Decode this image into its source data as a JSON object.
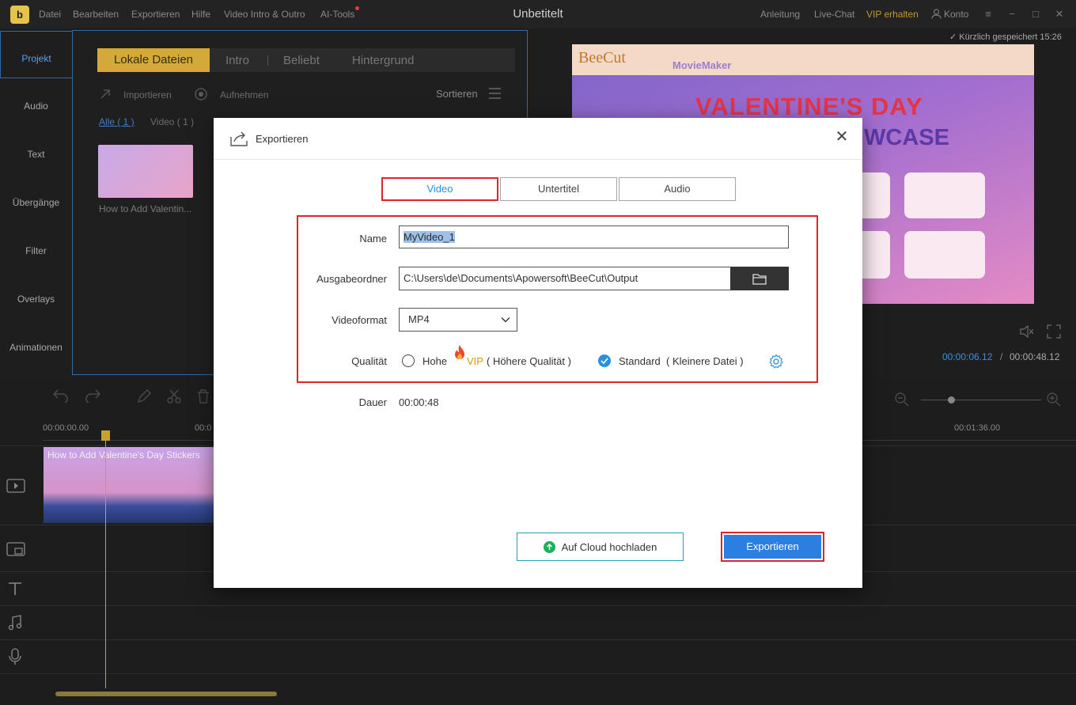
{
  "app": {
    "title": "Unbetitelt",
    "logo_glyph": "b",
    "menu": [
      "Datei",
      "Bearbeiten",
      "Exportieren",
      "Hilfe",
      "Video Intro & Outro",
      "AI-Tools"
    ],
    "right_menu": {
      "tutorial": "Anleitung",
      "live_chat": "Live-Chat",
      "vip": "VIP erhalten",
      "account": "Konto"
    },
    "saved_status": "Kürzlich gespeichert 15:26"
  },
  "leftnav": {
    "items": [
      "Projekt",
      "Audio",
      "Text",
      "Übergänge",
      "Filter",
      "Overlays",
      "Animationen"
    ]
  },
  "media": {
    "tabs": [
      "Lokale Dateien",
      "Intro",
      "Beliebt",
      "Hintergrund"
    ],
    "import_label": "Importieren",
    "record_label": "Aufnehmen",
    "sort_label": "Sortieren",
    "filter_all": "Alle ( 1 )",
    "filter_video": "Video ( 1 )",
    "thumb_caption": "How to Add Valentin..."
  },
  "preview": {
    "brand": "BeeCut",
    "brand_sub": "MovieMaker",
    "headline_1": "VALENTINE'S DAY",
    "headline_2": "WCASE",
    "time_current": "00:00:06.12",
    "time_sep": "/",
    "time_total": "00:00:48.12"
  },
  "timeline": {
    "ticks": [
      "00:00:00.00",
      "00:0",
      "00:01:36.00"
    ],
    "clip_title": "How to Add Valentine's Day Stickers"
  },
  "dialog": {
    "title": "Exportieren",
    "tabs": [
      "Video",
      "Untertitel",
      "Audio"
    ],
    "active_tab": "Video",
    "labels": {
      "name": "Name",
      "output_folder": "Ausgabeordner",
      "format": "Videoformat",
      "quality": "Qualität",
      "duration": "Dauer"
    },
    "name_value": "MyVideo_1",
    "output_path": "C:\\Users\\de\\Documents\\Apowersoft\\BeeCut\\Output",
    "format_value": "MP4",
    "quality": {
      "high": "Hohe",
      "vip": "VIP",
      "high_desc": "( Höhere Qualität )",
      "standard": "Standard",
      "standard_desc": "( Kleinere Datei )",
      "selected": "standard"
    },
    "duration_value": "00:00:48",
    "cloud_button": "Auf Cloud hochladen",
    "export_button": "Exportieren"
  },
  "colors": {
    "accent_blue": "#2b7fe0",
    "highlight_red": "#e0242a",
    "brand_gold": "#d4a93a",
    "cloud_green": "#1fae5c"
  }
}
